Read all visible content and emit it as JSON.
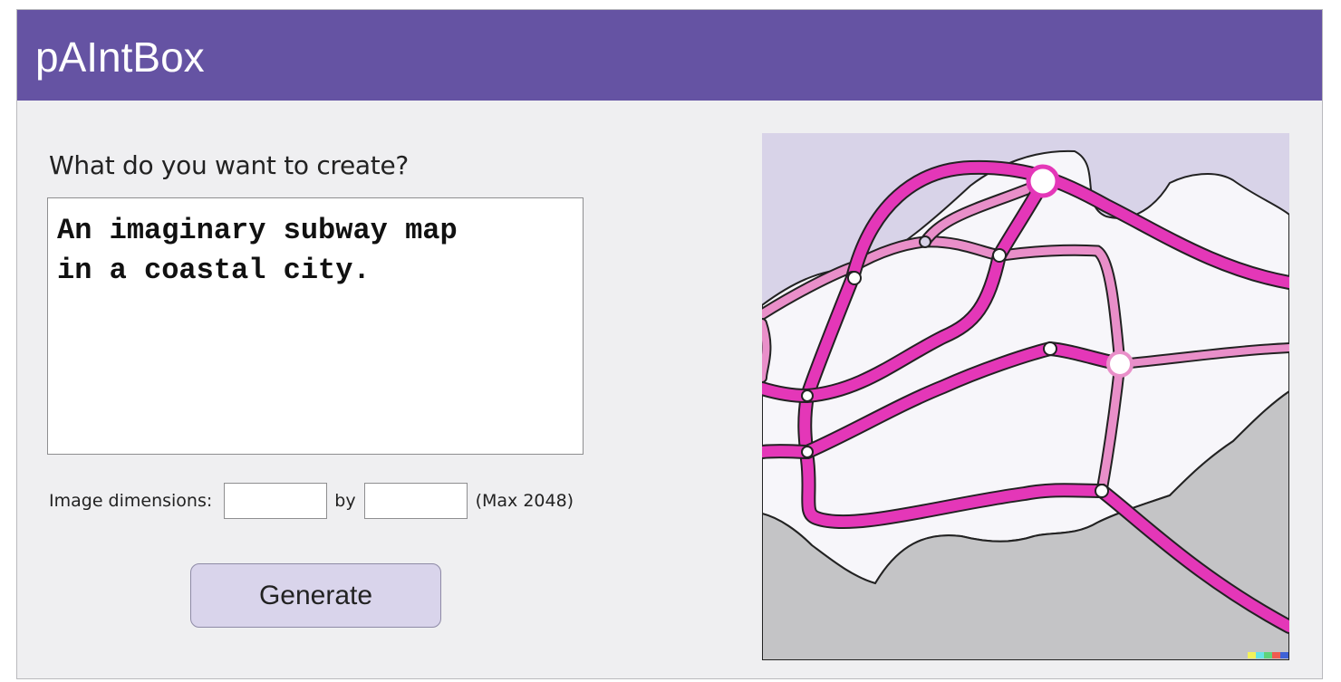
{
  "header": {
    "title": "pAIntBox",
    "color": "#6553a3"
  },
  "prompt": {
    "label": "What do you want to create?",
    "value": "An imaginary subway map\nin a coastal city."
  },
  "dimensions": {
    "label": "Image dimensions:",
    "width_value": "",
    "separator": "by",
    "height_value": "",
    "max_note": "(Max 2048)"
  },
  "generate_button": {
    "label": "Generate",
    "color": "#d9d4eb"
  },
  "generated_image": {
    "description_icon": "subway-map-image",
    "colors": {
      "sea": "#d8d3e8",
      "land": "#f7f6fa",
      "lowland": "#c4c4c6",
      "primary_line": "#e437b8",
      "secondary_line": "#e98fc9"
    }
  }
}
